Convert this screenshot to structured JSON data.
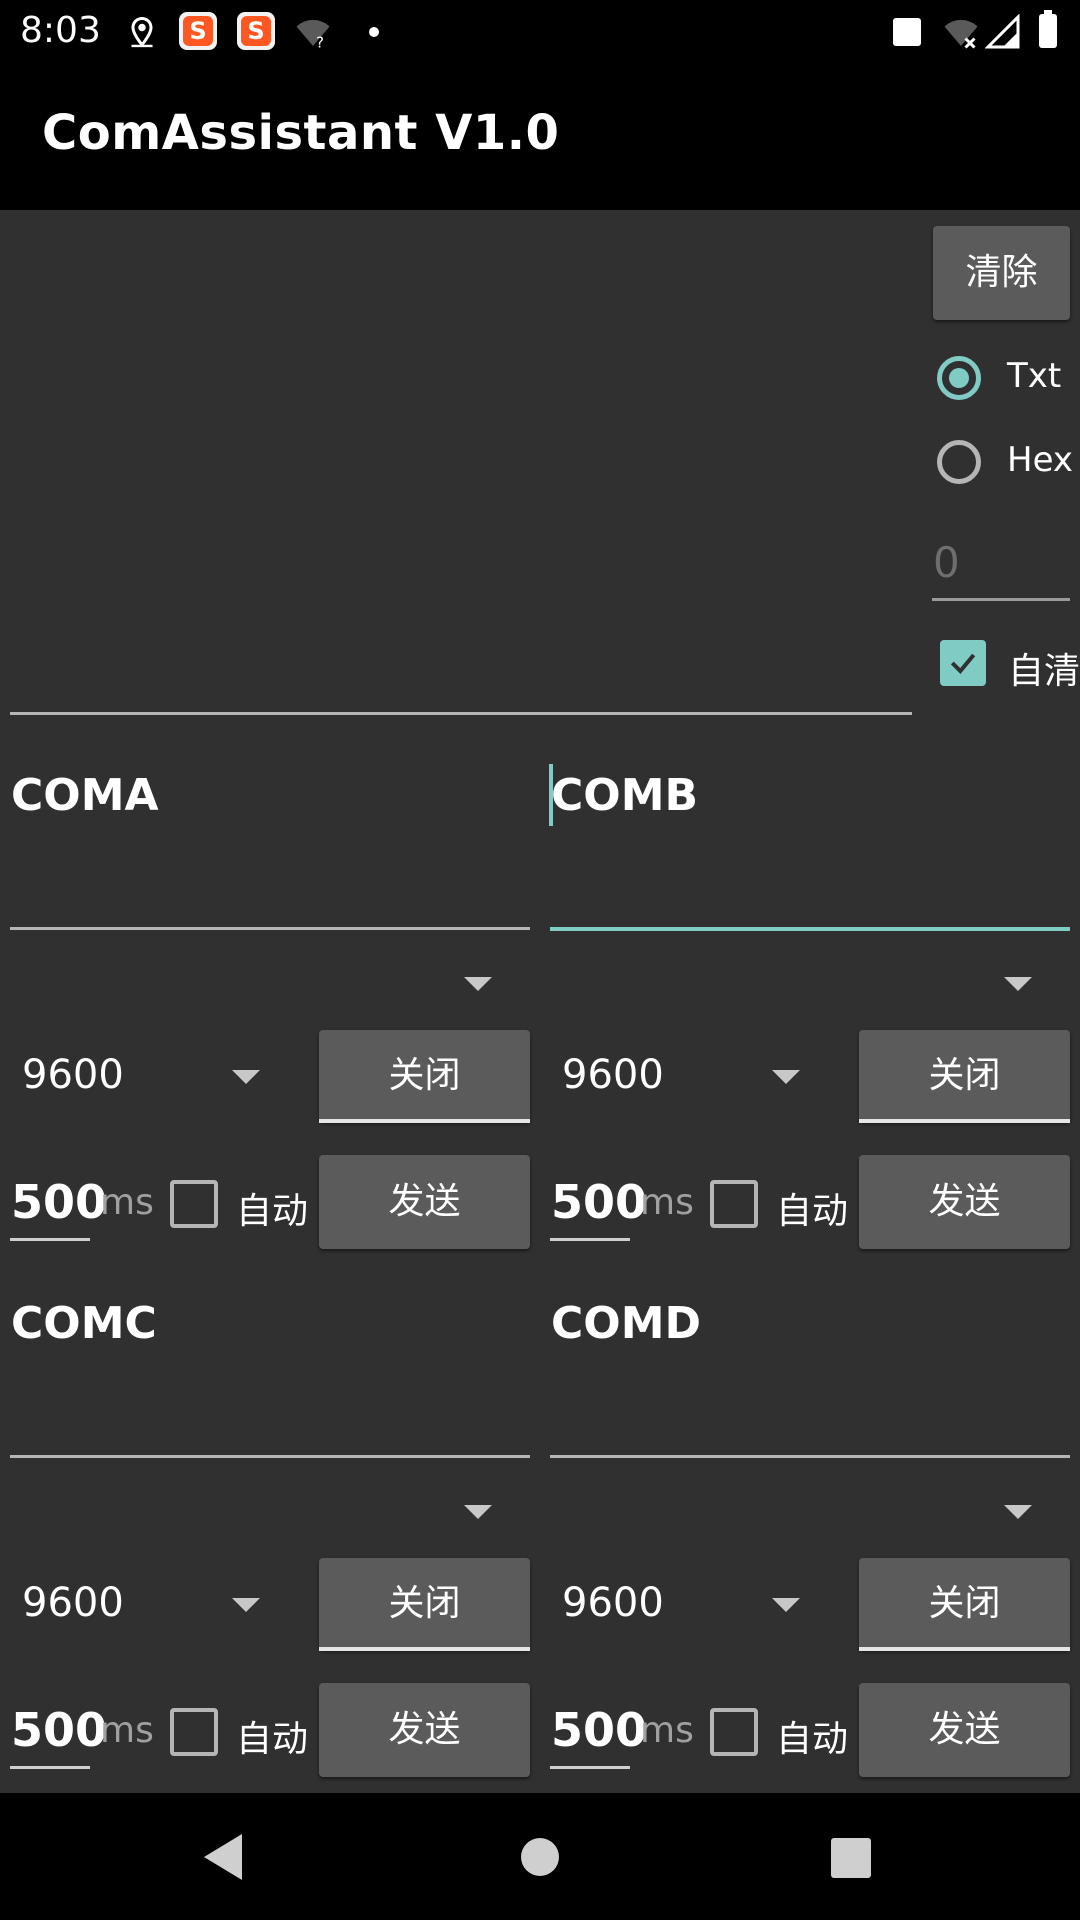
{
  "status_bar": {
    "time": "8:03",
    "icons": [
      "location-icon",
      "app-s-icon",
      "app-s-icon",
      "wifi-unknown-icon",
      "dot-icon",
      "battery-saver-square-icon",
      "wifi-off-icon",
      "signal-icon",
      "battery-icon"
    ],
    "app_s_glyph": "S"
  },
  "app_bar": {
    "title": "ComAssistant V1.0"
  },
  "controls": {
    "clear_label": "清除",
    "radio_txt": "Txt",
    "radio_hex": "Hex",
    "selected_mode": "Txt",
    "count_placeholder": "0",
    "auto_clear_label": "自清",
    "auto_clear_checked": true
  },
  "ports": [
    {
      "name": "COMA",
      "baud": "9600",
      "close_label": "关闭",
      "interval": "500",
      "ms_label": "ms",
      "auto_label": "自动",
      "send_label": "发送",
      "auto_checked": false
    },
    {
      "name": "COMB",
      "baud": "9600",
      "close_label": "关闭",
      "interval": "500",
      "ms_label": "ms",
      "auto_label": "自动",
      "send_label": "发送",
      "auto_checked": false,
      "focused": true
    },
    {
      "name": "COMC",
      "baud": "9600",
      "close_label": "关闭",
      "interval": "500",
      "ms_label": "ms",
      "auto_label": "自动",
      "send_label": "发送",
      "auto_checked": false
    },
    {
      "name": "COMD",
      "baud": "9600",
      "close_label": "关闭",
      "interval": "500",
      "ms_label": "ms",
      "auto_label": "自动",
      "send_label": "发送",
      "auto_checked": false
    }
  ],
  "colors": {
    "accent": "#80cbc4",
    "background": "#303030",
    "button": "#5b5b5c",
    "bar": "#000000"
  },
  "nav_bar": {
    "icons": [
      "back-icon",
      "home-icon",
      "recents-icon"
    ]
  }
}
